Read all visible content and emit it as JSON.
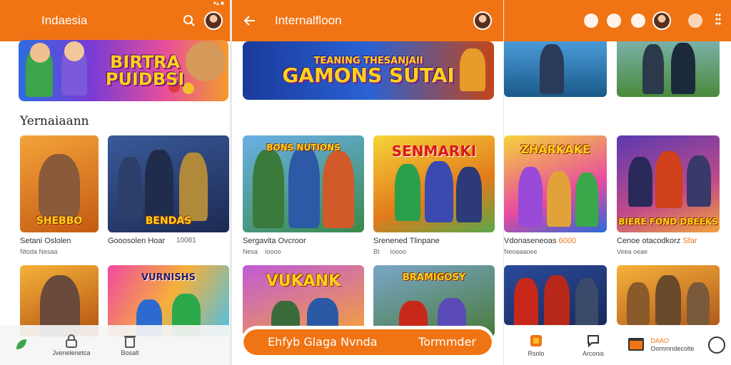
{
  "colors": {
    "accent": "#f07414",
    "banner_text": "#ffd21a"
  },
  "panel1": {
    "appbar": {
      "title": "Indaesia"
    },
    "status": "▾▴ ■",
    "banner": {
      "line1": "BIRTRA",
      "line2": "PUIDBSI"
    },
    "section_title": "Yernaiaann",
    "cards": [
      {
        "thumb_title": "SHEBBO",
        "name": "Setani Oslolen",
        "meta": "Ntoda Nesaa"
      },
      {
        "thumb_title": "BENDAS",
        "name": "Gooosolen Hoar",
        "meta_accent": "",
        "meta": "10081"
      },
      {
        "thumb_title": "",
        "name": "",
        "meta": ""
      },
      {
        "thumb_title": "VURNISHS",
        "name": "",
        "meta": ""
      }
    ],
    "bottom_nav": [
      {
        "icon": "leaf-icon",
        "label": ""
      },
      {
        "icon": "lock-icon",
        "label": "Jvenelenetca"
      },
      {
        "icon": "trash-icon",
        "label": "Bosalt"
      }
    ]
  },
  "panel2": {
    "appbar": {
      "title": "Internalfloon"
    },
    "banner": {
      "line1": "TEANING THESANJAII",
      "line2": "GAMONS SUTAI"
    },
    "cards": [
      {
        "thumb_title": "BONS NUTIONS",
        "name": "Sergavita Ovcroor",
        "meta": "Nesa",
        "meta2": "Ioooo"
      },
      {
        "thumb_title": "SENMARKI",
        "name": "Srenened Tlinpane",
        "meta": "Bt",
        "meta2": "Ioooo"
      },
      {
        "thumb_title": "VUKANK",
        "name": "",
        "meta": ""
      },
      {
        "thumb_title": "BRAMIGOSY",
        "name": "",
        "meta": ""
      }
    ],
    "cta": {
      "left": "Ehfyb Glaga Nvnda",
      "right": "Tormmder"
    }
  },
  "panel3": {
    "cards": [
      {
        "thumb_title": "",
        "name": "",
        "meta": ""
      },
      {
        "thumb_title": "",
        "name": "",
        "meta": ""
      },
      {
        "thumb_title": "ZHARKAKE",
        "name": "Vdonaseneoas",
        "name_accent": "6000",
        "meta": "Neoaaaoee"
      },
      {
        "thumb_title": "BIERE FOND DBEEKS",
        "name": "Cenoe otacodkorz",
        "name_accent": "Sfar",
        "meta": "Veea oeae"
      },
      {
        "thumb_title": "",
        "name": "",
        "meta": ""
      },
      {
        "thumb_title": "",
        "name": "",
        "meta": ""
      }
    ],
    "bottom_nav": [
      {
        "icon": "box-icon",
        "label": "Rsnlo"
      },
      {
        "icon": "chat-icon",
        "label": "Arconis"
      },
      {
        "icon": "terminal-icon",
        "label": "Oommndecolte",
        "label_top": "DAAO"
      }
    ]
  }
}
